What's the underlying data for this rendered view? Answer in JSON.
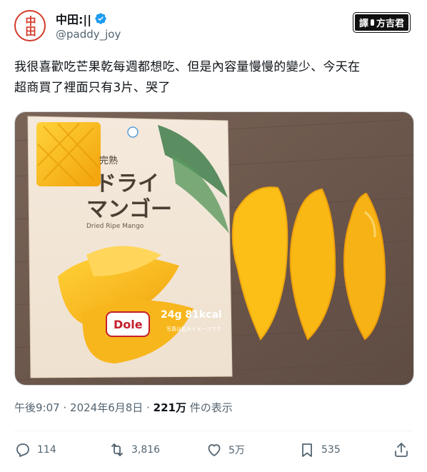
{
  "author": {
    "avatar_text": "中田",
    "display_name": "中田:||",
    "handle": "@paddy_joy",
    "verified_icon": "verified-badge-icon"
  },
  "translator_badge": {
    "left": "譯",
    "right": "方吉君"
  },
  "tweet": {
    "line1": "我很喜歡吃芒果乾每週都想吃、但是內容量慢慢的變少、今天在",
    "line2": "超商買了裡面只有3片、哭了"
  },
  "photo": {
    "package_label_small": "完熟",
    "package_title_line1": "ドライ",
    "package_title_line2": "マンゴー",
    "package_subtitle": "Dried Ripe Mango",
    "package_weight": "24g 81kcal",
    "package_brand": "Dole",
    "package_note": "写真は拡大イメージです"
  },
  "meta": {
    "time": "午後9:07",
    "sep1": "·",
    "date": "2024年6月8日",
    "sep2": "·",
    "views_count": "221万",
    "views_label": "件の表示"
  },
  "actions": {
    "reply_count": "114",
    "retweet_count": "3,816",
    "like_count": "5万",
    "bookmark_count": "535"
  },
  "colors": {
    "accent": "#1d9bf0",
    "text_primary": "#0f1419",
    "text_secondary": "#536471",
    "avatar_red": "#d23a2a",
    "mango": "#f6b512"
  }
}
